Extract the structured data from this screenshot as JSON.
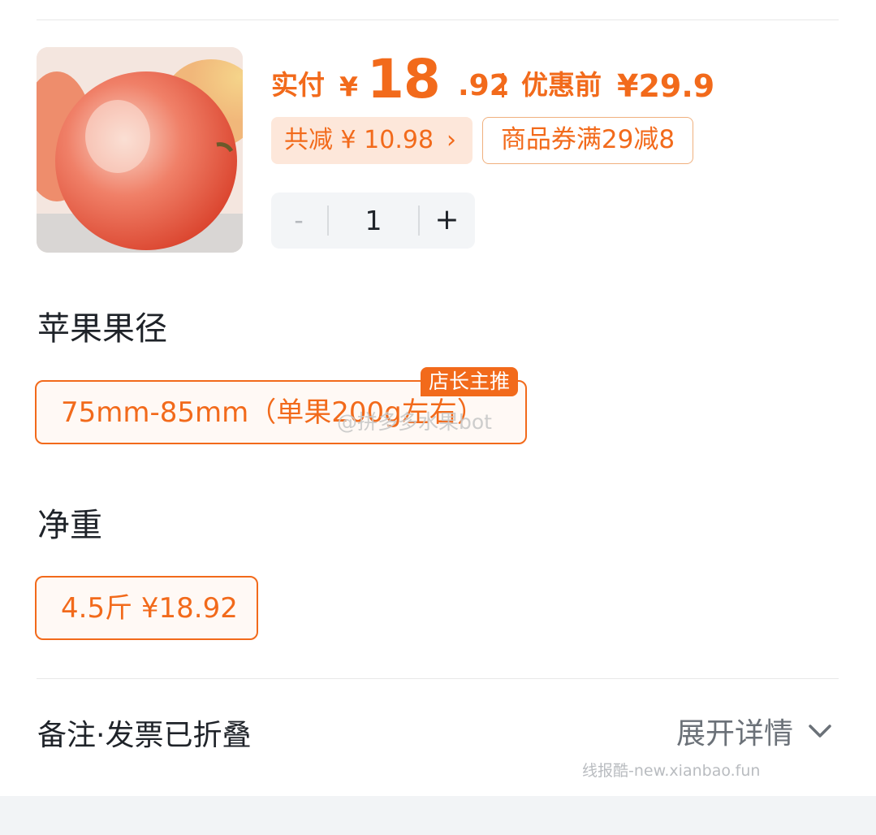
{
  "price": {
    "paid_label": "实付",
    "currency": "¥",
    "paid_integer": "18",
    "paid_decimal": ".92",
    "original_label": "优惠前",
    "original_value": "¥29.9"
  },
  "discount": {
    "total_saving": "共减 ¥ 10.98",
    "coupon": "商品券满29减8"
  },
  "quantity": {
    "minus": "-",
    "value": "1",
    "plus": "+"
  },
  "spec_size": {
    "title": "苹果果径",
    "option": "75mm-85mm（单果200g左右）",
    "tag": "店长主推"
  },
  "spec_weight": {
    "title": "净重",
    "option": "4.5斤  ¥18.92"
  },
  "remark": {
    "label": "备注·发票已折叠",
    "expand": "展开详情"
  },
  "watermarks": {
    "weibo": "@拼多多水果bot",
    "site": "线报酷-new.xianbao.fun"
  },
  "colors": {
    "accent": "#f26a1b",
    "chip_bg": "#fde7da",
    "stepper_bg": "#f3f5f7"
  },
  "icons": {
    "product": "apple-photo",
    "chevron_right": "chevron-right-icon",
    "chevron_down": "chevron-down-icon"
  }
}
